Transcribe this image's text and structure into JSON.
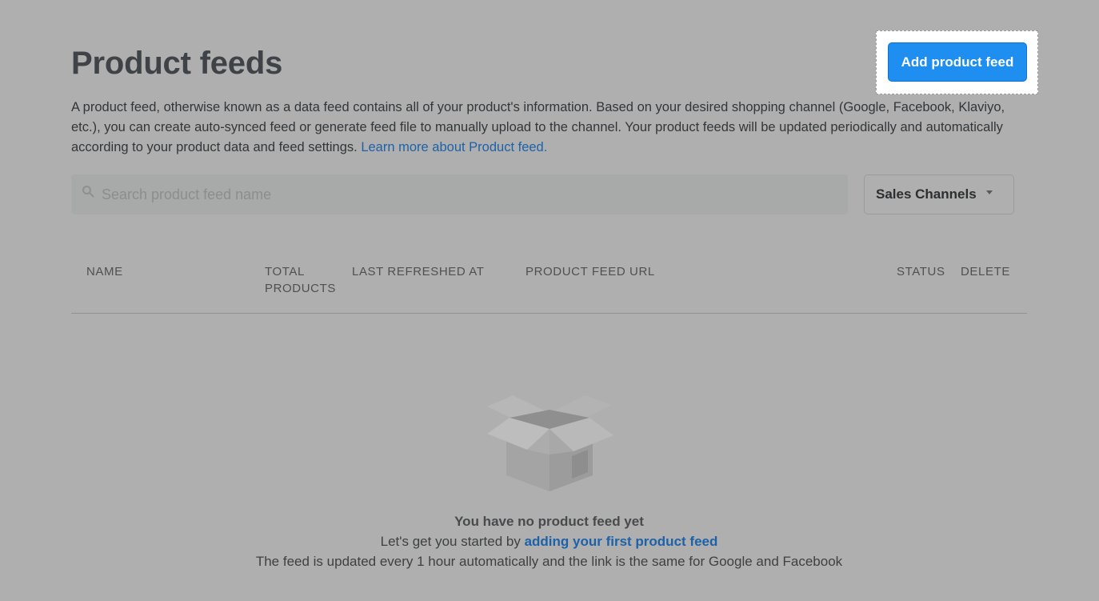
{
  "header": {
    "title": "Product feeds",
    "add_button_label": "Add product feed"
  },
  "description": {
    "text": "A product feed, otherwise known as a data feed contains all of your product's information. Based on your desired shopping channel (Google, Facebook, Klaviyo, etc.), you can create auto-synced feed or generate feed file to manually upload to the channel. Your product feeds will be updated periodically and automatically according to your product data and feed settings. ",
    "link_text": "Learn more about Product feed."
  },
  "search": {
    "placeholder": "Search product feed name",
    "value": "",
    "icon": "search-icon"
  },
  "filter": {
    "label": "Sales Channels",
    "icon": "caret-down-icon"
  },
  "table": {
    "columns": [
      "NAME",
      "TOTAL PRODUCTS",
      "LAST REFRESHED AT",
      "PRODUCT FEED URL",
      "STATUS",
      "DELETE"
    ]
  },
  "empty_state": {
    "icon": "open-box-icon",
    "title": "You have no product feed yet",
    "prompt_prefix": "Let's get you started by ",
    "prompt_link": "adding your first product feed",
    "note": "The feed is updated every 1 hour automatically and the link is the same for Google and Facebook"
  },
  "colors": {
    "overlay_background": "#afafaf",
    "primary_button": "#1e8ef0",
    "link": "#1d62a8"
  }
}
